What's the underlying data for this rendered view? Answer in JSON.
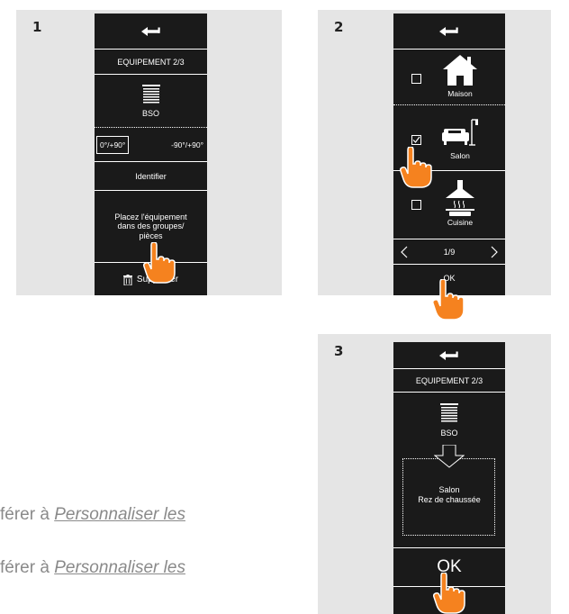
{
  "steps": {
    "one": "1",
    "two": "2",
    "three": "3"
  },
  "panel1": {
    "header": "EQUIPEMENT 2/3",
    "device_label": "BSO",
    "angle_option_a": "0°/+90°",
    "angle_option_b": "-90°/+90°",
    "identify": "Identifier",
    "place_text": "Placez l'équipement dans des groupes/ pièces",
    "delete": "Supprimer"
  },
  "panel2": {
    "room1": "Maison",
    "room2": "Salon",
    "room3": "Cuisine",
    "pager": "1/9",
    "ok": "OK",
    "room1_checked": false,
    "room2_checked": true,
    "room3_checked": false
  },
  "panel3": {
    "header": "EQUIPEMENT 2/3",
    "device_label": "BSO",
    "dest_line1": "Salon",
    "dest_line2": "Rez de chaussée",
    "ok": "OK"
  },
  "captions": [
    {
      "prefix": "férer à ",
      "link": "Personnaliser les "
    },
    {
      "prefix": "férer à ",
      "link": "Personnaliser les "
    }
  ],
  "colors": {
    "panel_bg": "#e5e5e5",
    "device_bg": "#1a1a1a",
    "hand": "#f5821f",
    "caption": "#8a8a8a"
  },
  "icons": [
    "back-arrow-icon",
    "blind-icon",
    "trash-icon",
    "house-icon",
    "sofa-icon",
    "range-hood-icon",
    "chevron-left-icon",
    "chevron-right-icon",
    "down-arrow-icon",
    "pointing-hand-icon"
  ]
}
